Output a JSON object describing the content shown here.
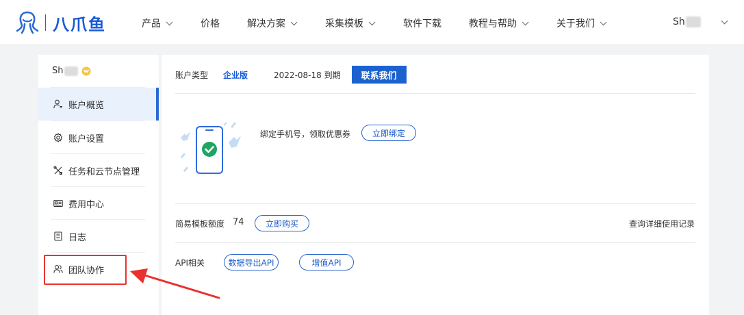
{
  "brand": {
    "name": "八爪鱼",
    "color": "#1a5bd6"
  },
  "nav": [
    {
      "label": "产品",
      "dropdown": true
    },
    {
      "label": "价格",
      "dropdown": false
    },
    {
      "label": "解决方案",
      "dropdown": true
    },
    {
      "label": "采集模板",
      "dropdown": true
    },
    {
      "label": "软件下载",
      "dropdown": false
    },
    {
      "label": "教程与帮助",
      "dropdown": true
    },
    {
      "label": "关于我们",
      "dropdown": true
    }
  ],
  "user": {
    "name_prefix": "Sh"
  },
  "sidebar": {
    "user_name_prefix": "Sh",
    "items": [
      {
        "label": "账户概览",
        "icon": "user-list-icon",
        "active": true
      },
      {
        "label": "账户设置",
        "icon": "gear-icon",
        "active": false
      },
      {
        "label": "任务和云节点管理",
        "icon": "tools-icon",
        "active": false
      },
      {
        "label": "费用中心",
        "icon": "id-card-icon",
        "active": false
      },
      {
        "label": "日志",
        "icon": "document-icon",
        "active": false
      },
      {
        "label": "团队协作",
        "icon": "team-icon",
        "active": false
      }
    ]
  },
  "account": {
    "type_label": "账户类型",
    "type_value": "企业版",
    "expire": "2022-08-18 到期",
    "contact_label": "联系我们"
  },
  "bind": {
    "text": "绑定手机号，领取优惠券",
    "button": "立即绑定"
  },
  "quota": {
    "label": "简易模板额度",
    "value": "74",
    "buy_button": "立即购买",
    "detail_link": "查询详细使用记录"
  },
  "api": {
    "label": "API相关",
    "buttons": [
      "数据导出API",
      "增值API"
    ]
  },
  "colors": {
    "accent": "#1b62cf",
    "highlight": "#e8322f",
    "active_bg": "#e8f1fc"
  }
}
